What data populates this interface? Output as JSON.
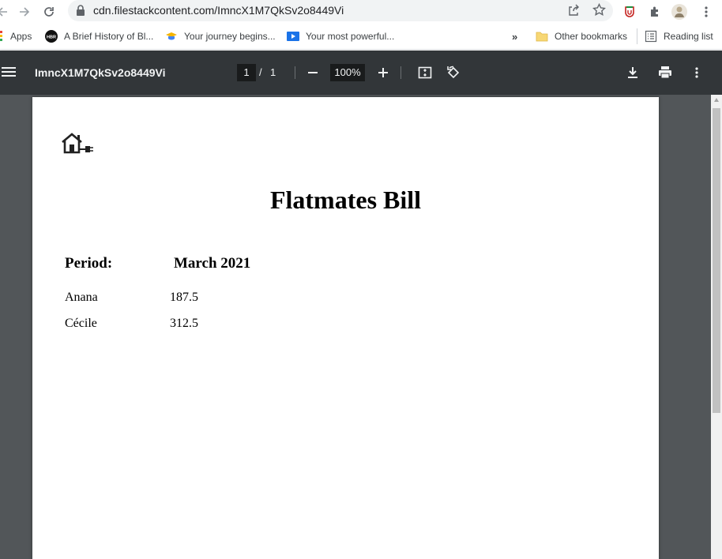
{
  "browser": {
    "url": "cdn.filestackcontent.com/ImncX1M7QkSv2o8449Vi"
  },
  "bookmarks": {
    "apps_label": "Apps",
    "items": [
      {
        "label": "A Brief History of Bl...",
        "icon": "hbr-icon"
      },
      {
        "label": "Your journey begins...",
        "icon": "graduation-cap-icon"
      },
      {
        "label": "Your most powerful...",
        "icon": "video-play-icon"
      }
    ],
    "overflow_label": "»",
    "other_label": "Other bookmarks",
    "reading_list_label": "Reading list"
  },
  "pdf_toolbar": {
    "title": "ImncX1M7QkSv2o8449Vi",
    "current_page": "1",
    "page_separator": "/",
    "total_pages": "1",
    "zoom": "100%"
  },
  "document": {
    "title": "Flatmates Bill",
    "period_label": "Period:",
    "period_value": "March 2021",
    "rows": [
      {
        "name": "Anana",
        "amount": "187.5"
      },
      {
        "name": "Cécile",
        "amount": "312.5"
      }
    ]
  },
  "colors": {
    "pdf_toolbar_bg": "#323639",
    "viewer_bg": "#525659",
    "omnibox_bg": "#f1f3f4"
  }
}
